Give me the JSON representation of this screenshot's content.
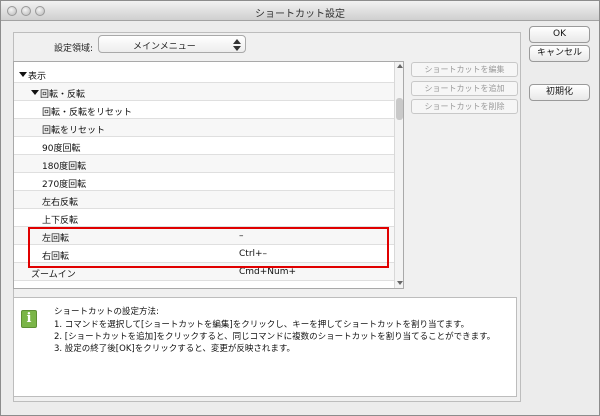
{
  "window": {
    "title": "ショートカット設定"
  },
  "region": {
    "label": "設定領域:",
    "value": "メインメニュー"
  },
  "list": {
    "rows": [
      {
        "name": "表示",
        "key": "",
        "level": 0,
        "expanded": true
      },
      {
        "name": "回転・反転",
        "key": "",
        "level": 1,
        "expanded": true
      },
      {
        "name": "回転・反転をリセット",
        "key": "",
        "level": 2
      },
      {
        "name": "回転をリセット",
        "key": "",
        "level": 2
      },
      {
        "name": "90度回転",
        "key": "",
        "level": 2
      },
      {
        "name": "180度回転",
        "key": "",
        "level": 2
      },
      {
        "name": "270度回転",
        "key": "",
        "level": 2
      },
      {
        "name": "左右反転",
        "key": "",
        "level": 2
      },
      {
        "name": "上下反転",
        "key": "",
        "level": 2
      },
      {
        "name": "左回転",
        "key": "–",
        "level": 2
      },
      {
        "name": "右回転",
        "key": "Ctrl+–",
        "level": 2
      },
      {
        "name": "ズームイン",
        "key": "Cmd+Num+",
        "level": 1
      }
    ]
  },
  "side_buttons": {
    "edit": "ショートカットを編集",
    "add": "ショートカットを追加",
    "delete": "ショートカットを削除"
  },
  "main_buttons": {
    "ok": "OK",
    "cancel": "キャンセル",
    "reset": "初期化"
  },
  "help": {
    "icon": "i",
    "title": "ショートカットの設定方法:",
    "lines": [
      "1. コマンドを選択して[ショートカットを編集]をクリックし、キーを押してショートカットを割り当てます。",
      "2. [ショートカットを追加]をクリックすると、同じコマンドに複数のショートカットを割り当てることができます。",
      "3. 設定の終了後[OK]をクリックすると、変更が反映されます。"
    ]
  },
  "colors": {
    "highlight": "#e00000",
    "info_icon": "#7ab547"
  }
}
